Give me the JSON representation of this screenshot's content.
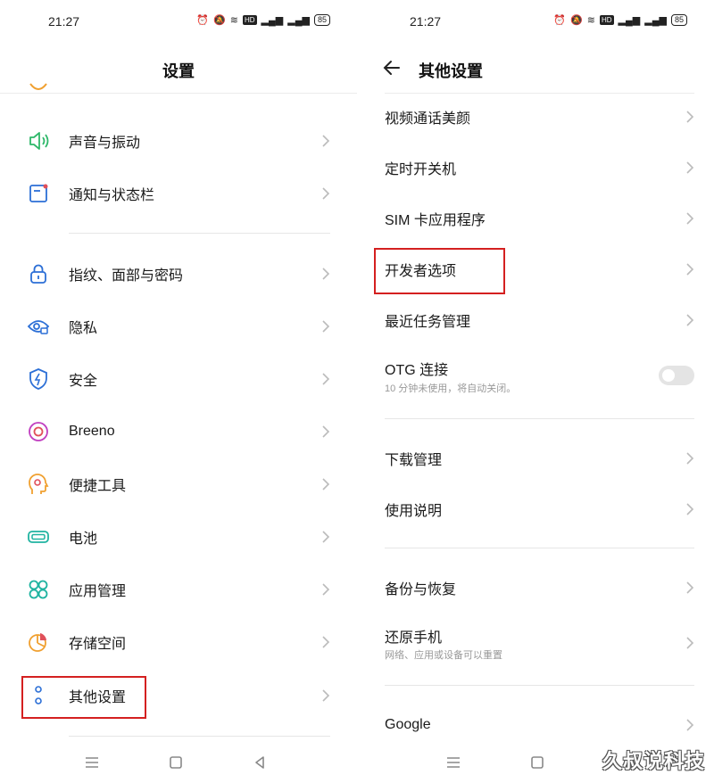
{
  "left": {
    "status": {
      "time": "21:27",
      "battery": "85",
      "hd": "HD"
    },
    "title": "设置",
    "items": [
      {
        "label": "声音与振动",
        "icon": "volume-icon"
      },
      {
        "label": "通知与状态栏",
        "icon": "notification-icon"
      },
      {
        "label": "指纹、面部与密码",
        "icon": "lock-icon"
      },
      {
        "label": "隐私",
        "icon": "privacy-eye-icon"
      },
      {
        "label": "安全",
        "icon": "shield-icon"
      },
      {
        "label": "Breeno",
        "icon": "breeno-icon"
      },
      {
        "label": "便捷工具",
        "icon": "tools-icon"
      },
      {
        "label": "电池",
        "icon": "battery-icon"
      },
      {
        "label": "应用管理",
        "icon": "apps-icon"
      },
      {
        "label": "存储空间",
        "icon": "storage-pie-icon"
      },
      {
        "label": "其他设置",
        "icon": "more-dots-icon"
      }
    ]
  },
  "right": {
    "status": {
      "time": "21:27",
      "battery": "85",
      "hd": "HD"
    },
    "title": "其他设置",
    "items": [
      {
        "label": "视频通话美颜"
      },
      {
        "label": "定时开关机"
      },
      {
        "label": "SIM 卡应用程序"
      },
      {
        "label": "开发者选项"
      },
      {
        "label": "最近任务管理"
      },
      {
        "label": "OTG 连接",
        "sub": "10 分钟未使用，将自动关闭。"
      },
      {
        "label": "下载管理"
      },
      {
        "label": "使用说明"
      },
      {
        "label": "备份与恢复"
      },
      {
        "label": "还原手机",
        "sub": "网络、应用或设备可以重置"
      },
      {
        "label": "Google"
      }
    ]
  },
  "watermark": "久叔说科技",
  "colors": {
    "highlight": "#d42020",
    "accent_blue": "#2c6fd6",
    "accent_green": "#2fb86a",
    "accent_red": "#e0505a",
    "accent_orange": "#f0a030"
  }
}
